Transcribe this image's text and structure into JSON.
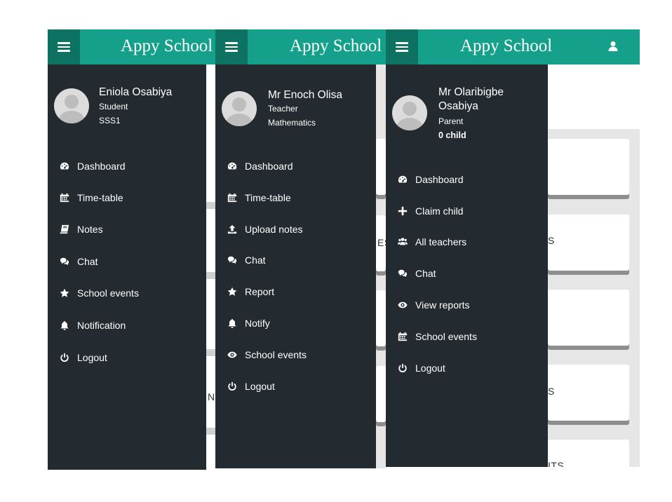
{
  "app_title": "Appy School",
  "student": {
    "name": "Eniola Osabiya",
    "role": "Student",
    "class": "SSS1",
    "menu": [
      {
        "icon": "dashboard-icon",
        "label": "Dashboard"
      },
      {
        "icon": "calendar-icon",
        "label": "Time-table"
      },
      {
        "icon": "book-icon",
        "label": "Notes"
      },
      {
        "icon": "chat-icon",
        "label": "Chat"
      },
      {
        "icon": "star-icon",
        "label": "School events"
      },
      {
        "icon": "bell-icon",
        "label": "Notification"
      },
      {
        "icon": "power-icon",
        "label": "Logout"
      }
    ],
    "bg_fragments": [
      "NT"
    ]
  },
  "teacher": {
    "name": "Mr Enoch Olisa",
    "role": "Teacher",
    "subject": "Mathematics",
    "menu": [
      {
        "icon": "dashboard-icon",
        "label": "Dashboard"
      },
      {
        "icon": "calendar-icon",
        "label": "Time-table"
      },
      {
        "icon": "upload-icon",
        "label": "Upload notes"
      },
      {
        "icon": "chat-icon",
        "label": "Chat"
      },
      {
        "icon": "star-icon",
        "label": "Report"
      },
      {
        "icon": "bell-icon",
        "label": "Notify"
      },
      {
        "icon": "eye-icon",
        "label": "School events"
      },
      {
        "icon": "power-icon",
        "label": "Logout"
      }
    ],
    "bg_fragments": [
      "ES"
    ]
  },
  "parent": {
    "name_line1": "Mr Olaribigbe",
    "name_line2": "Osabiya",
    "role": "Parent",
    "children": "0 child",
    "menu": [
      {
        "icon": "dashboard-icon",
        "label": "Dashboard"
      },
      {
        "icon": "plus-icon",
        "label": "Claim child"
      },
      {
        "icon": "users-icon",
        "label": "All teachers"
      },
      {
        "icon": "chat-icon",
        "label": "Chat"
      },
      {
        "icon": "eye-icon",
        "label": "View reports"
      },
      {
        "icon": "calendar-icon",
        "label": "School events"
      },
      {
        "icon": "power-icon",
        "label": "Logout"
      }
    ],
    "bg_fragments": [
      "S",
      "S",
      "ITS"
    ]
  },
  "colors": {
    "appbar": "#14a08a",
    "menu_button": "#0d7261",
    "drawer": "#232b30"
  }
}
